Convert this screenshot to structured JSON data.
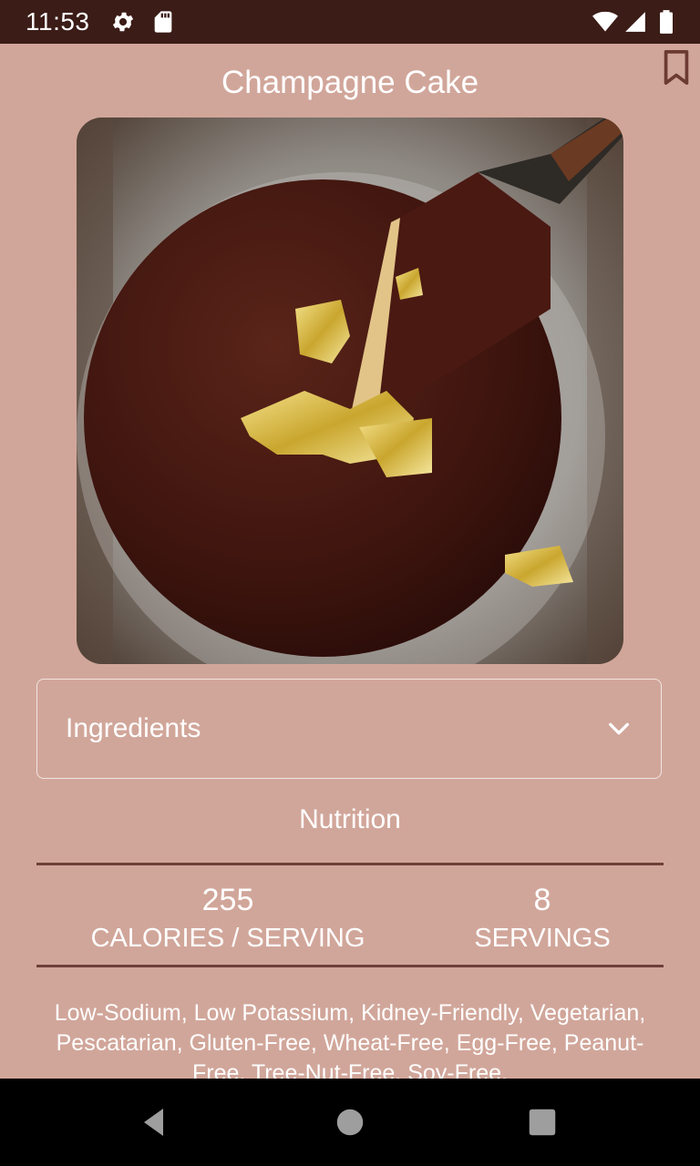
{
  "status_bar": {
    "time": "11:53",
    "icons": [
      "gear-icon",
      "sd-card-icon",
      "wifi-icon",
      "cell-signal-icon",
      "battery-icon"
    ]
  },
  "recipe": {
    "title": "Champagne Cake",
    "bookmark_icon": "bookmark-icon",
    "image_description_icon": "cake-photo"
  },
  "ingredients": {
    "label": "Ingredients",
    "expand_icon": "chevron-down-icon"
  },
  "nutrition": {
    "heading": "Nutrition",
    "calories_value": "255",
    "calories_label": "CALORIES / SERVING",
    "servings_value": "8",
    "servings_label": "SERVINGS",
    "health_labels": "Low-Sodium, Low Potassium, Kidney-Friendly, Vegetarian, Pescatarian, Gluten-Free, Wheat-Free, Egg-Free, Peanut-Free, Tree-Nut-Free, Soy-Free,"
  },
  "nav_bar": {
    "icons": [
      "back-icon",
      "home-icon",
      "recents-icon"
    ]
  },
  "colors": {
    "background": "#d1a69a",
    "status_bar": "#3b1c17",
    "divider": "#6d4139",
    "nav_bar": "#000000"
  }
}
